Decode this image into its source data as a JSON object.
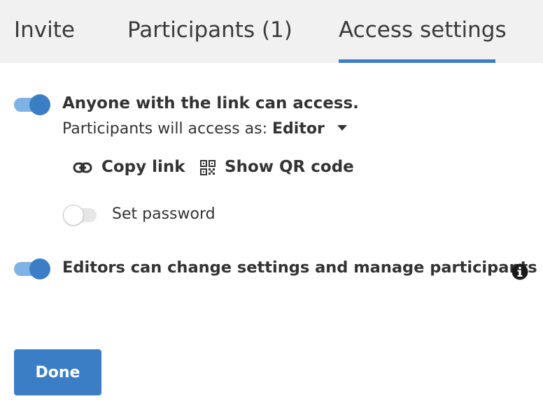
{
  "tabs": [
    {
      "label": "Invite"
    },
    {
      "label": "Participants (1)"
    },
    {
      "label": "Access settings"
    }
  ],
  "link_access": {
    "label": "Anyone with the link can access.",
    "enabled": true,
    "access_prefix": "Participants will access as:",
    "access_value": "Editor"
  },
  "actions": {
    "copy_link": "Copy link",
    "show_qr": "Show QR code"
  },
  "password": {
    "label": "Set password",
    "enabled": false
  },
  "editors": {
    "label": "Editors can change settings and manage participants",
    "enabled": true
  },
  "done_label": "Done",
  "colors": {
    "accent": "#3b7ec6",
    "toggle_track_on": "#7fb2e5",
    "tab_bar_bg": "#f1f1f1",
    "text": "#333333"
  },
  "icons": {
    "copy_link": "link-icon",
    "show_qr": "qr-code-icon",
    "info": "info-icon",
    "dropdown": "caret-down-icon"
  }
}
